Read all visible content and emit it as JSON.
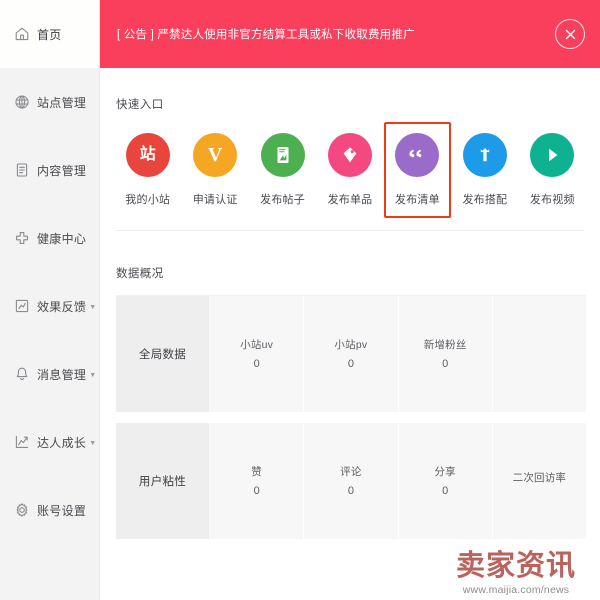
{
  "sidebar": {
    "items": [
      {
        "label": "首页",
        "icon": "home-icon",
        "active": true,
        "caret": false
      },
      {
        "label": "站点管理",
        "icon": "globe-icon",
        "active": false,
        "caret": false
      },
      {
        "label": "内容管理",
        "icon": "document-icon",
        "active": false,
        "caret": false
      },
      {
        "label": "健康中心",
        "icon": "plus-cross-icon",
        "active": false,
        "caret": false
      },
      {
        "label": "效果反馈",
        "icon": "chart-box-icon",
        "active": false,
        "caret": true
      },
      {
        "label": "消息管理",
        "icon": "bell-icon",
        "active": false,
        "caret": true
      },
      {
        "label": "达人成长",
        "icon": "trend-up-icon",
        "active": false,
        "caret": true
      },
      {
        "label": "账号设置",
        "icon": "gear-icon",
        "active": false,
        "caret": false
      }
    ],
    "caret_glyph": "▼"
  },
  "banner": {
    "text": "[ 公告 ] 严禁达人使用非官方结算工具或私下收取费用推广",
    "background_color": "#fa3f5c",
    "close_icon": "close-circle-icon"
  },
  "quick_entry": {
    "title": "快速入口",
    "items": [
      {
        "label": "我的小站",
        "glyph": "站",
        "color": "#e8453c",
        "icon": "station-icon",
        "highlighted": false
      },
      {
        "label": "申请认证",
        "glyph": "V",
        "color": "#f5a623",
        "icon": "verify-icon",
        "highlighted": false
      },
      {
        "label": "发布帖子",
        "glyph": "▤",
        "color": "#4caf50",
        "icon": "post-icon",
        "highlighted": false
      },
      {
        "label": "发布单品",
        "glyph": "◆",
        "color": "#f44881",
        "icon": "item-icon",
        "highlighted": false
      },
      {
        "label": "发布清单",
        "glyph": "❝",
        "color": "#9b6bc9",
        "icon": "list-icon",
        "highlighted": true
      },
      {
        "label": "发布搭配",
        "glyph": "⇧",
        "color": "#1e9be8",
        "icon": "outfit-icon",
        "highlighted": false
      },
      {
        "label": "发布视频",
        "glyph": "▶",
        "color": "#0fb290",
        "icon": "video-icon",
        "highlighted": false
      }
    ],
    "highlight_color": "#ee3b16"
  },
  "data_overview": {
    "title": "数据概况",
    "rows": [
      {
        "header": "全局数据",
        "cells": [
          {
            "label": "小站uv",
            "value": "0"
          },
          {
            "label": "小站pv",
            "value": "0"
          },
          {
            "label": "新增粉丝",
            "value": "0"
          },
          {
            "label": "",
            "value": ""
          }
        ]
      },
      {
        "header": "用户粘性",
        "cells": [
          {
            "label": "赞",
            "value": "0"
          },
          {
            "label": "评论",
            "value": "0"
          },
          {
            "label": "分享",
            "value": "0"
          },
          {
            "label": "二次回访率",
            "value": ""
          }
        ]
      }
    ]
  },
  "watermark": {
    "logo": "卖家资讯",
    "url": "www.maijia.com/news"
  }
}
